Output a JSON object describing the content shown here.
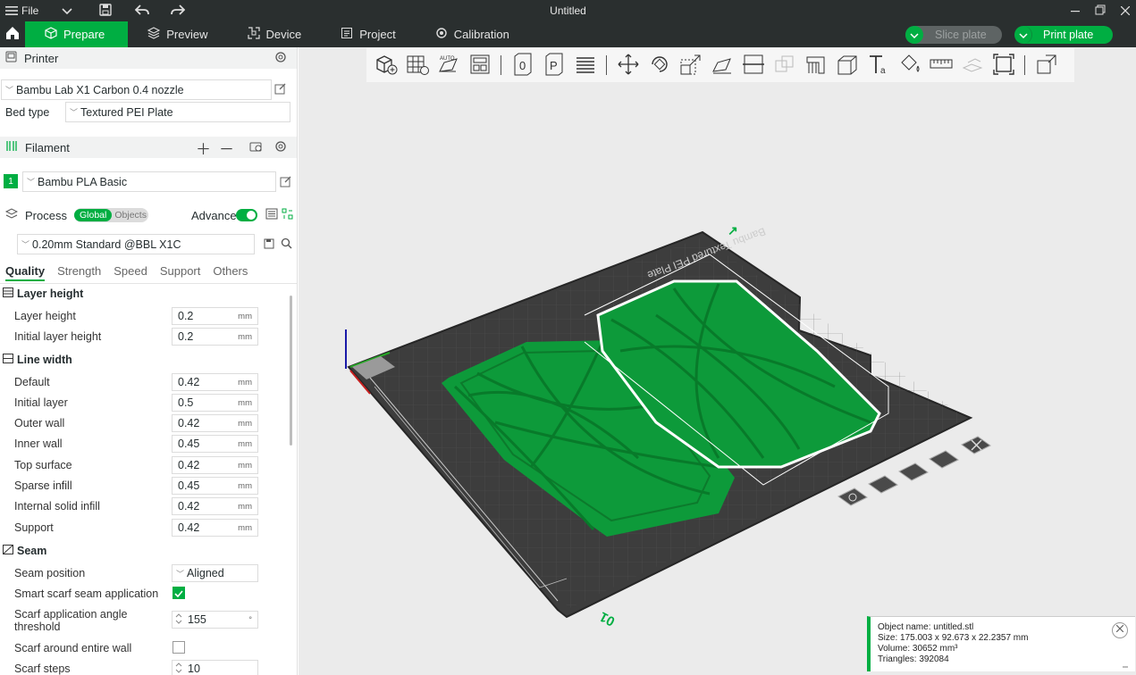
{
  "titlebar": {
    "file_label": "File",
    "title": "Untitled"
  },
  "tabs": [
    {
      "label": "Prepare",
      "icon": "cube-icon"
    },
    {
      "label": "Preview",
      "icon": "layers-icon"
    },
    {
      "label": "Device",
      "icon": "device-icon"
    },
    {
      "label": "Project",
      "icon": "project-icon"
    },
    {
      "label": "Calibration",
      "icon": "calibration-icon"
    }
  ],
  "actions": {
    "slice": "Slice plate",
    "print": "Print plate"
  },
  "printer": {
    "section": "Printer",
    "preset": "Bambu Lab X1 Carbon 0.4 nozzle",
    "bed_label": "Bed type",
    "bed_value": "Textured PEI Plate"
  },
  "filament": {
    "section": "Filament",
    "index": "1",
    "name": "Bambu PLA Basic",
    "color": "#00ae42"
  },
  "process": {
    "section": "Process",
    "global": "Global",
    "objects": "Objects",
    "advance": "Advance",
    "preset": "0.20mm Standard @BBL X1C"
  },
  "subtabs": [
    "Quality",
    "Strength",
    "Speed",
    "Support",
    "Others"
  ],
  "groups": {
    "layer_height": {
      "title": "Layer height",
      "rows": [
        {
          "label": "Layer height",
          "value": "0.2",
          "unit": "mm"
        },
        {
          "label": "Initial layer height",
          "value": "0.2",
          "unit": "mm"
        }
      ]
    },
    "line_width": {
      "title": "Line width",
      "rows": [
        {
          "label": "Default",
          "value": "0.42",
          "unit": "mm"
        },
        {
          "label": "Initial layer",
          "value": "0.5",
          "unit": "mm"
        },
        {
          "label": "Outer wall",
          "value": "0.42",
          "unit": "mm"
        },
        {
          "label": "Inner wall",
          "value": "0.45",
          "unit": "mm"
        },
        {
          "label": "Top surface",
          "value": "0.42",
          "unit": "mm"
        },
        {
          "label": "Sparse infill",
          "value": "0.45",
          "unit": "mm"
        },
        {
          "label": "Internal solid infill",
          "value": "0.42",
          "unit": "mm"
        },
        {
          "label": "Support",
          "value": "0.42",
          "unit": "mm"
        }
      ]
    },
    "seam": {
      "title": "Seam",
      "position_label": "Seam position",
      "position_value": "Aligned",
      "smart_label": "Smart scarf seam application",
      "angle_label_1": "Scarf application angle",
      "angle_label_2": "threshold",
      "angle_value": "155",
      "angle_unit": "°",
      "entire_label": "Scarf around entire wall",
      "steps_label": "Scarf steps",
      "steps_value": "10"
    }
  },
  "plate": {
    "label": "Bambu Textured PEI Plate",
    "number": "01"
  },
  "info": {
    "name": "Object name: untitled.stl",
    "size": "Size: 175.003 x 92.673 x 22.2357 mm",
    "volume": "Volume: 30652 mm³",
    "triangles": "Triangles: 392084"
  }
}
